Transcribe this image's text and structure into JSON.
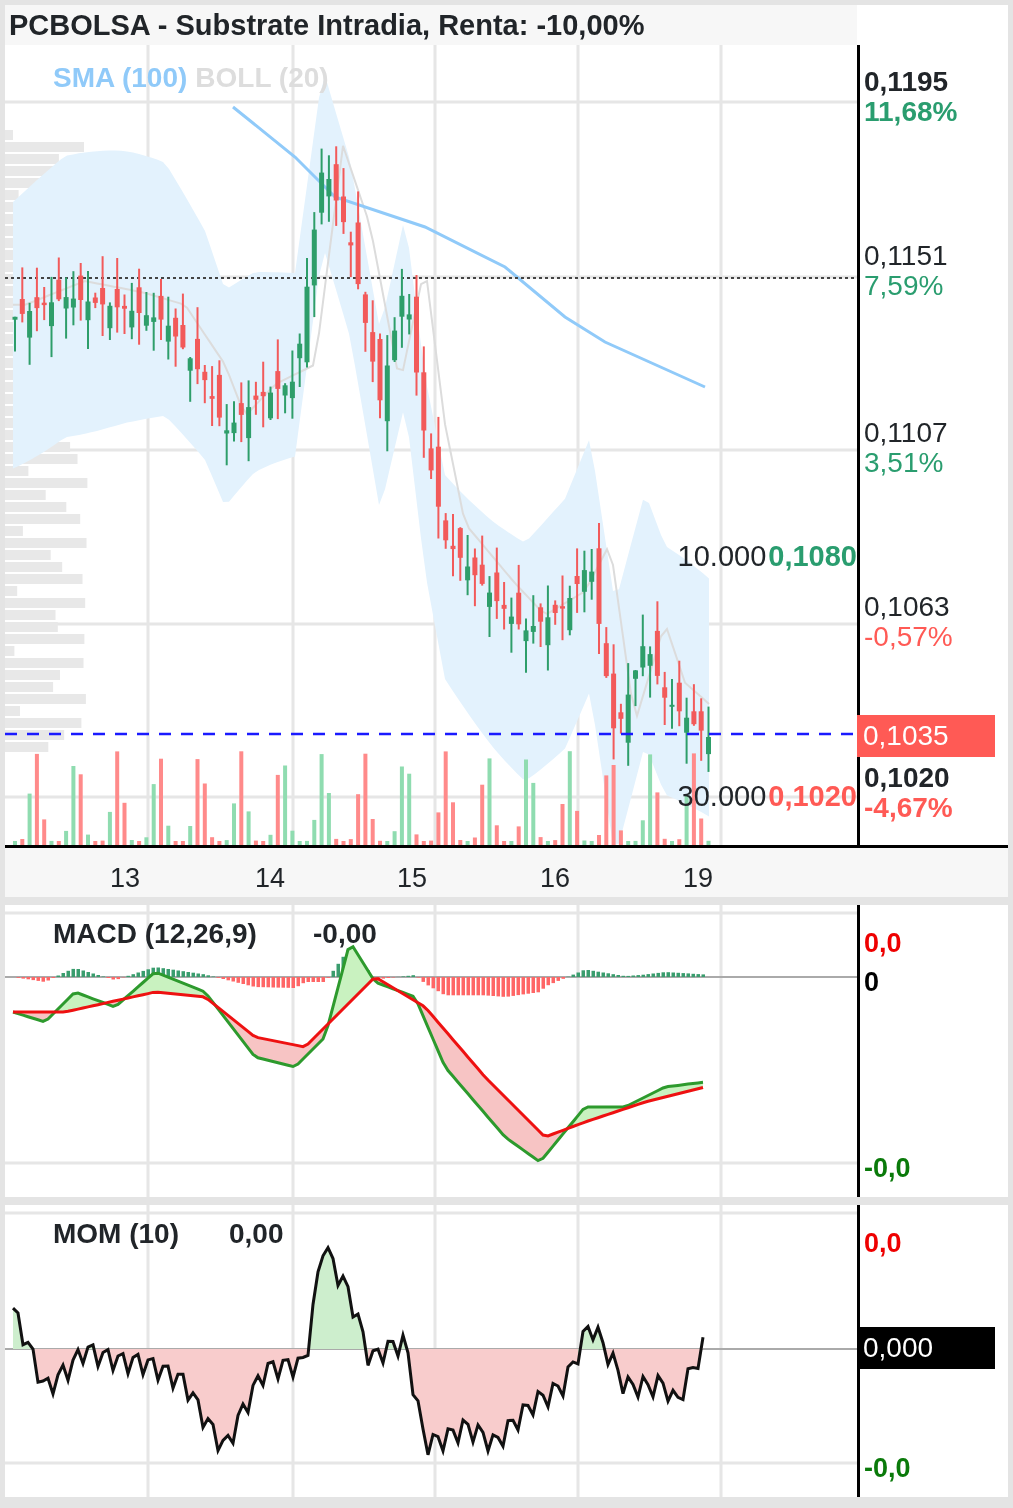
{
  "title": "PCBOLSA - Substrate Intradia, Renta: -10,00%",
  "price_panel": {
    "legend": [
      {
        "label": "SMA (100)",
        "color": "#90caf9"
      },
      {
        "label": "BOLL (20)",
        "color": "#dddddd"
      }
    ],
    "axis_labels": [
      {
        "price": "0,1195",
        "change": "11,68%",
        "color": "#2a9d6f",
        "bold": true
      },
      {
        "price": "0,1151",
        "change": "7,59%",
        "color": "#2a9d6f",
        "bold": false
      },
      {
        "price": "0,1107",
        "change": "3,51%",
        "color": "#2a9d6f",
        "bold": false
      },
      {
        "price": "0,1063",
        "change": "-0,57%",
        "color": "#ff5a55",
        "bold": false
      },
      {
        "price": "0,1020",
        "change": "-4,67%",
        "color": "#ff5a55",
        "bold": true
      }
    ],
    "current_price": "0,1035",
    "marker_labels": [
      {
        "volume": "10.000",
        "price": "0,1080",
        "color": "#2a9d6f"
      },
      {
        "volume": "30.000",
        "price": "0,1020",
        "color": "#ff5a55"
      }
    ],
    "x_labels": [
      "13",
      "14",
      "15",
      "16",
      "19"
    ]
  },
  "macd_panel": {
    "title": "MACD (12,26,9)",
    "value": "-0,00",
    "axis_labels": [
      {
        "text": "0,0",
        "color": "#ee0000"
      },
      {
        "text": "0",
        "color": "#000000"
      },
      {
        "text": "-0,0",
        "color": "#0a7a0a"
      }
    ]
  },
  "mom_panel": {
    "title": "MOM (10)",
    "value": "0,00",
    "current": "0,000",
    "axis_labels": [
      {
        "text": "0,0",
        "color": "#ee0000"
      },
      {
        "text": "-0,0",
        "color": "#0a7a0a"
      }
    ]
  }
}
